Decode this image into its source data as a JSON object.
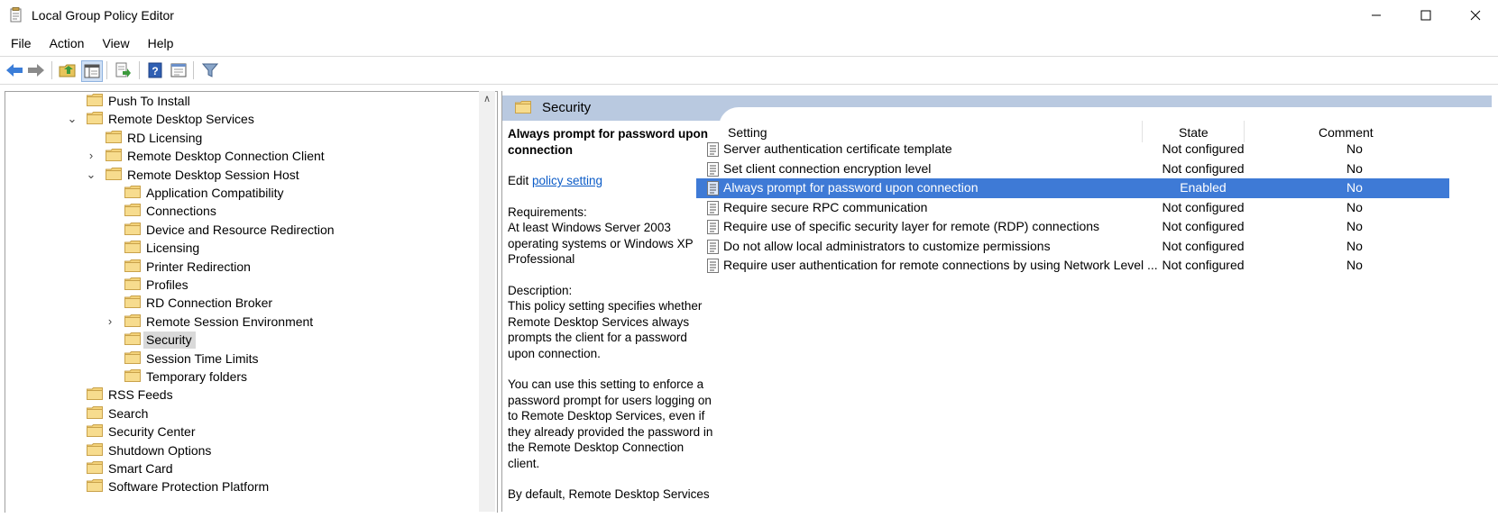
{
  "window": {
    "title": "Local Group Policy Editor",
    "minimize": "—",
    "maximize": "☐",
    "close": "✕"
  },
  "menu": [
    "File",
    "Action",
    "View",
    "Help"
  ],
  "toolbar": {
    "icons": [
      "back-arrow-icon",
      "forward-arrow-icon",
      "up-folder-icon",
      "show-hide-tree-icon",
      "export-list-icon",
      "help-icon",
      "properties-icon",
      "filter-icon"
    ]
  },
  "tree": {
    "items": [
      {
        "label": "Push To Install",
        "level": 0,
        "expander": ""
      },
      {
        "label": "Remote Desktop Services",
        "level": 0,
        "expander": "⌄"
      },
      {
        "label": "RD Licensing",
        "level": 1,
        "expander": ""
      },
      {
        "label": "Remote Desktop Connection Client",
        "level": 1,
        "expander": "›"
      },
      {
        "label": "Remote Desktop Session Host",
        "level": 1,
        "expander": "⌄"
      },
      {
        "label": "Application Compatibility",
        "level": 2,
        "expander": ""
      },
      {
        "label": "Connections",
        "level": 2,
        "expander": ""
      },
      {
        "label": "Device and Resource Redirection",
        "level": 2,
        "expander": ""
      },
      {
        "label": "Licensing",
        "level": 2,
        "expander": ""
      },
      {
        "label": "Printer Redirection",
        "level": 2,
        "expander": ""
      },
      {
        "label": "Profiles",
        "level": 2,
        "expander": ""
      },
      {
        "label": "RD Connection Broker",
        "level": 2,
        "expander": ""
      },
      {
        "label": "Remote Session Environment",
        "level": 2,
        "expander": "›"
      },
      {
        "label": "Security",
        "level": 2,
        "expander": "",
        "selected": true
      },
      {
        "label": "Session Time Limits",
        "level": 2,
        "expander": ""
      },
      {
        "label": "Temporary folders",
        "level": 2,
        "expander": ""
      },
      {
        "label": "RSS Feeds",
        "level": 0,
        "expander": ""
      },
      {
        "label": "Search",
        "level": 0,
        "expander": ""
      },
      {
        "label": "Security Center",
        "level": 0,
        "expander": ""
      },
      {
        "label": "Shutdown Options",
        "level": 0,
        "expander": ""
      },
      {
        "label": "Smart Card",
        "level": 0,
        "expander": ""
      },
      {
        "label": "Software Protection Platform",
        "level": 0,
        "expander": ""
      }
    ]
  },
  "section": {
    "title": "Security"
  },
  "description": {
    "title": "Always prompt for password upon connection",
    "edit_prefix": "Edit ",
    "edit_link": "policy setting ",
    "requirements_label": "Requirements:",
    "requirements_text": "At least Windows Server 2003 operating systems or Windows XP Professional",
    "description_label": "Description:",
    "description_text": "This policy setting specifies whether Remote Desktop Services always prompts the client for a password upon connection.",
    "para2": "You can use this setting to enforce a password prompt for users logging on to Remote Desktop Services, even if they already provided the password in the Remote Desktop Connection client.",
    "para3": "By default, Remote Desktop Services"
  },
  "list": {
    "headers": {
      "setting": "Setting",
      "state": "State",
      "comment": "Comment"
    },
    "rows": [
      {
        "name": "Server authentication certificate template",
        "state": "Not configured",
        "comment": "No"
      },
      {
        "name": "Set client connection encryption level",
        "state": "Not configured",
        "comment": "No"
      },
      {
        "name": "Always prompt for password upon connection",
        "state": "Enabled",
        "comment": "No",
        "selected": true
      },
      {
        "name": "Require secure RPC communication",
        "state": "Not configured",
        "comment": "No"
      },
      {
        "name": "Require use of specific security layer for remote (RDP) connections",
        "state": "Not configured",
        "comment": "No"
      },
      {
        "name": "Do not allow local administrators to customize permissions",
        "state": "Not configured",
        "comment": "No"
      },
      {
        "name": "Require user authentication for remote connections by using Network Level ...",
        "state": "Not configured",
        "comment": "No"
      }
    ]
  },
  "colors": {
    "selection": "#3e7ad6",
    "section_header": "#b9c9e0",
    "folder": "#f3d27a",
    "link": "#0b5bc7"
  }
}
